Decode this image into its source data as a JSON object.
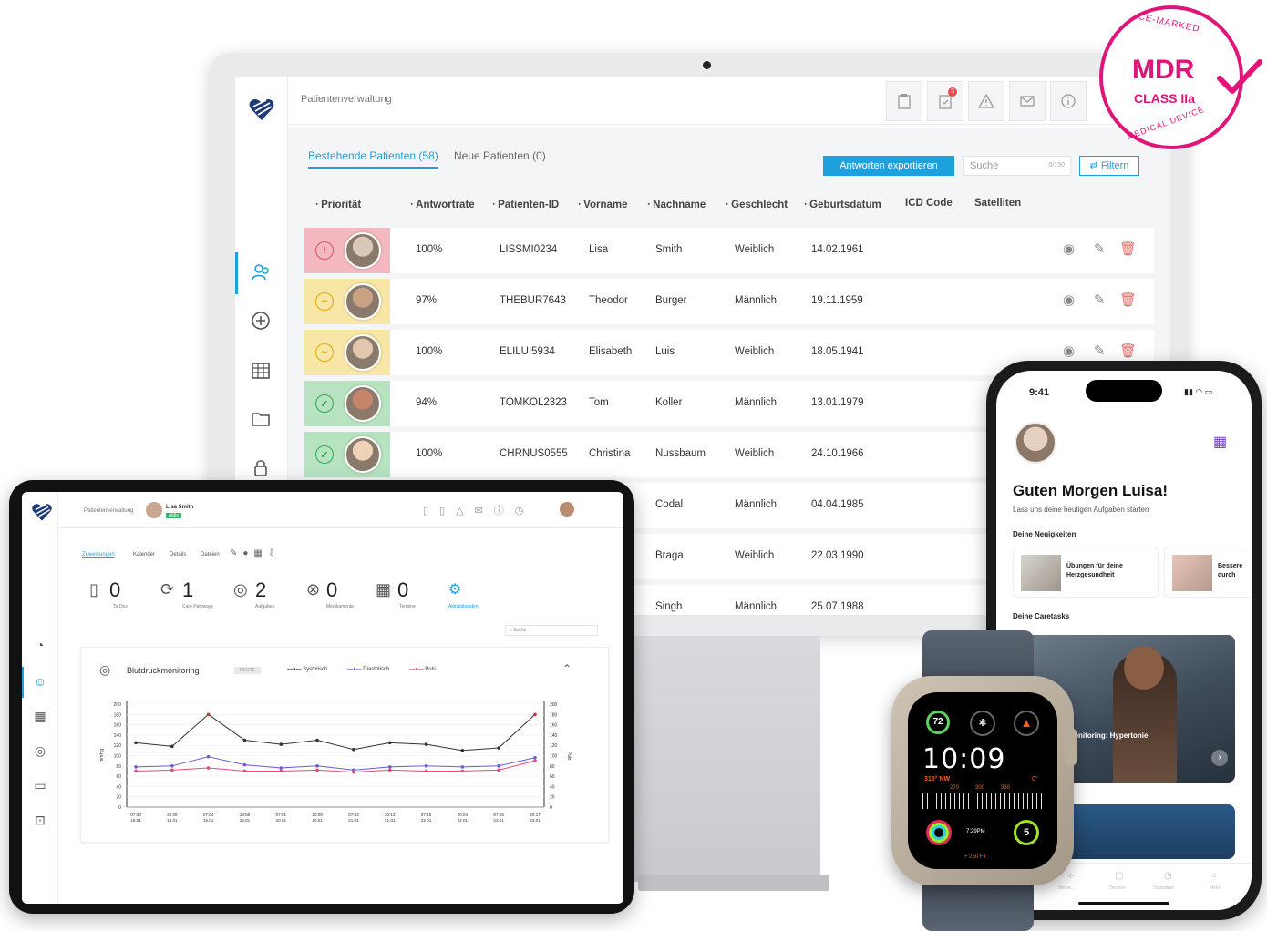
{
  "monitor": {
    "header_title": "Patientenverwaltung",
    "header_badge": "3",
    "tabs": [
      "Bestehende Patienten (58)",
      "Neue Patienten (0)"
    ],
    "export_button": "Antworten exportieren",
    "search_placeholder": "Suche",
    "search_count": "0/150",
    "filter_button": "Filtern",
    "columns": [
      "Priorität",
      "Antwortrate",
      "Patienten-ID",
      "Vorname",
      "Nachname",
      "Geschlecht",
      "Geburtsdatum",
      "ICD Code",
      "Satelliten"
    ],
    "rows": [
      {
        "priority": "red",
        "rate": "100%",
        "id": "LISSMI0234",
        "first": "Lisa",
        "last": "Smith",
        "gender": "Weiblich",
        "dob": "14.02.1961"
      },
      {
        "priority": "yellow",
        "rate": "97%",
        "id": "THEBUR7643",
        "first": "Theodor",
        "last": "Burger",
        "gender": "Männlich",
        "dob": "19.11.1959"
      },
      {
        "priority": "yellow",
        "rate": "100%",
        "id": "ELILUI5934",
        "first": "Elisabeth",
        "last": "Luis",
        "gender": "Weiblich",
        "dob": "18.05.1941"
      },
      {
        "priority": "green",
        "rate": "94%",
        "id": "TOMKOL2323",
        "first": "Tom",
        "last": "Koller",
        "gender": "Männlich",
        "dob": "13.01.1979"
      },
      {
        "priority": "green",
        "rate": "100%",
        "id": "CHRNUS0555",
        "first": "Christina",
        "last": "Nussbaum",
        "gender": "Weiblich",
        "dob": "24.10.1966"
      },
      {
        "priority": "",
        "rate": "",
        "id": "",
        "first": "",
        "last": "Codal",
        "gender": "Männlich",
        "dob": "04.04.1985"
      },
      {
        "priority": "",
        "rate": "",
        "id": "",
        "first": "",
        "last": "Braga",
        "gender": "Weiblich",
        "dob": "22.03.1990"
      },
      {
        "priority": "",
        "rate": "",
        "id": "",
        "first": "",
        "last": "Singh",
        "gender": "Männlich",
        "dob": "25.07.1988"
      }
    ]
  },
  "tablet": {
    "header_title": "Patientenverwaltung",
    "patient_name": "Lisa Smith",
    "patient_tag": "Aktiv",
    "tabs": [
      "Zuweisungen",
      "Kalender",
      "Details",
      "Dateien"
    ],
    "stats": [
      {
        "num": "0",
        "label": "To-Dos"
      },
      {
        "num": "1",
        "label": "Care Pathways"
      },
      {
        "num": "2",
        "label": "Aufgaben"
      },
      {
        "num": "0",
        "label": "Medikamente"
      },
      {
        "num": "0",
        "label": "Termine"
      }
    ],
    "stat_extra_label": "Aktivitätsdaten",
    "search_placeholder": "Suche",
    "card_title": "Blutdruckmonitoring",
    "card_tag": "HEUTE",
    "legend": [
      "Systolisch",
      "Diastolisch",
      "Puls"
    ],
    "y_left_label": "mmHg",
    "y_right_label": "Puls"
  },
  "chart_data": {
    "type": "line",
    "title": "Blutdruckmonitoring",
    "x": [
      "07:00 18.01",
      "20:00 18.01",
      "07:04 19.01",
      "19:56 19.01",
      "07:01 20.01",
      "20:00 20.01",
      "07:03 21.01",
      "20:13 21.01",
      "07:15 22.01",
      "20:04 22.01",
      "07:15 23.01",
      "20:17 23.01"
    ],
    "ylim": [
      0,
      200
    ],
    "y_ticks": [
      0,
      20,
      40,
      60,
      80,
      100,
      120,
      140,
      160,
      180,
      200
    ],
    "series": [
      {
        "name": "Systolisch",
        "color": "#333333",
        "values": [
          125,
          118,
          180,
          130,
          122,
          130,
          112,
          125,
          122,
          110,
          115,
          180
        ]
      },
      {
        "name": "Diastolisch",
        "color": "#6a5cd8",
        "values": [
          78,
          80,
          98,
          82,
          76,
          80,
          72,
          78,
          80,
          78,
          80,
          96
        ]
      },
      {
        "name": "Puls",
        "color": "#e84a7a",
        "values": [
          70,
          72,
          76,
          70,
          70,
          72,
          68,
          72,
          70,
          70,
          72,
          90
        ]
      }
    ]
  },
  "phone": {
    "time": "9:41",
    "greeting": "Guten Morgen Luisa!",
    "subtitle": "Lass uns deine heutigen Aufgaben starten",
    "news_heading": "Deine Neuigkeiten",
    "news": [
      "Übungen für deine Herzgesundheit",
      "Bessere durch"
    ],
    "caretasks_heading": "Deine Caretasks",
    "caretask_label": "monitoring: Hypertonie",
    "tabs": [
      "Meine...",
      "Termine",
      "Statistiken",
      "Mehr"
    ]
  },
  "watch": {
    "time": "10:09",
    "heart": "72",
    "heading": "315° NW",
    "degrees": "0°",
    "compass_ticks": [
      "270",
      "300",
      "330"
    ],
    "sunset": "7:29PM",
    "count": "5",
    "elevation": "+ 250 FT"
  },
  "badge": {
    "top": "CE-MARKED",
    "main": "MDR",
    "class": "CLASS IIa",
    "bottom": "MEDICAL DEVICE"
  },
  "colors": {
    "accent": "#1ea0dc",
    "priority_red": "#f4b9c0",
    "priority_yellow": "#f8e6a6",
    "priority_green": "#b7e3c0",
    "badge": "#e0157a"
  }
}
